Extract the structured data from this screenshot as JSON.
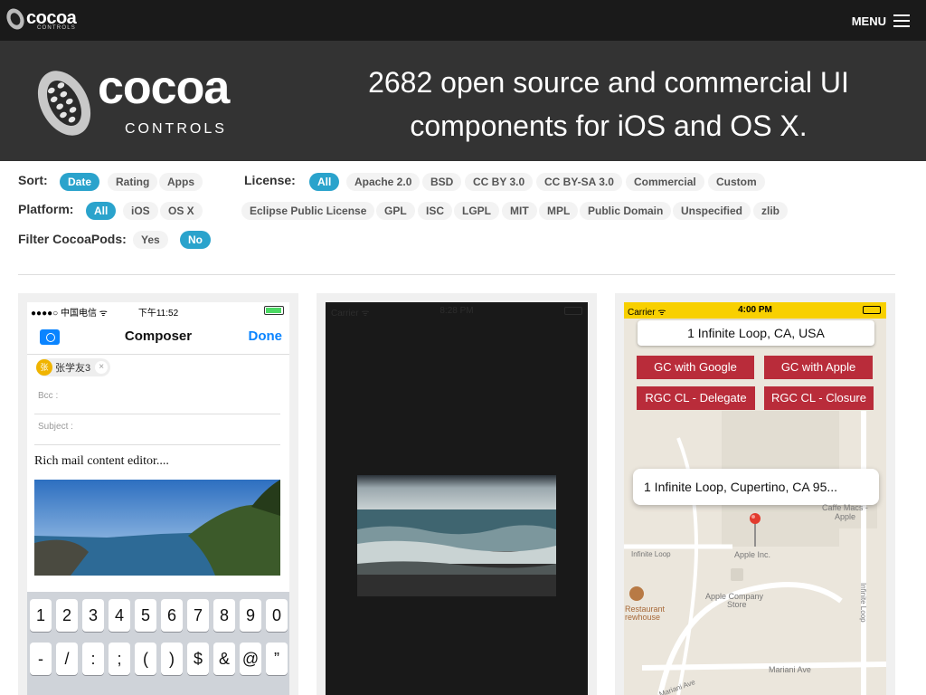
{
  "topbar": {
    "brand": "cocoa",
    "brand_sub": "CONTROLS",
    "menu_label": "MENU"
  },
  "hero": {
    "brand": "cocoa",
    "brand_sub": "CONTROLS",
    "tagline_1": "2682 open source and commercial UI",
    "tagline_2": "components for iOS and OS X."
  },
  "filters": {
    "sort_label": "Sort:",
    "sort": [
      "Date",
      "Rating",
      "Apps"
    ],
    "platform_label": "Platform:",
    "platform": [
      "All",
      "iOS",
      "OS X"
    ],
    "cocoapods_label": "Filter CocoaPods:",
    "cocoapods": [
      "Yes",
      "No"
    ],
    "license_label": "License:",
    "license": [
      "All",
      "Apache 2.0",
      "BSD",
      "CC BY 3.0",
      "CC BY-SA 3.0",
      "Commercial",
      "Custom",
      "Eclipse Public License",
      "GPL",
      "ISC",
      "LGPL",
      "MIT",
      "MPL",
      "Public Domain",
      "Unspecified",
      "zlib"
    ]
  },
  "cards": {
    "composer": {
      "carrier": "●●●●○ 中国电信 ᯤ",
      "time": "下午11:52",
      "title": "Composer",
      "done": "Done",
      "contact": "张学友3",
      "contact_initial": "张",
      "bcc": "Bcc :",
      "subject": "Subject :",
      "body": "Rich mail content editor....",
      "keys_row1": [
        "1",
        "2",
        "3",
        "4",
        "5",
        "6",
        "7",
        "8",
        "9",
        "0"
      ],
      "keys_row2": [
        "-",
        "/",
        ":",
        ";",
        "(",
        ")",
        "$",
        "&",
        "@",
        "”"
      ]
    },
    "photo_viewer": {
      "carrier": "Carrier ᯤ",
      "time": "8:28 PM"
    },
    "map": {
      "carrier": "Carrier ᯤ",
      "time": "4:00 PM",
      "search": "1 Infinite Loop, CA, USA",
      "btn_google": "GC with Google",
      "btn_apple": "GC with Apple",
      "btn_delegate": "RGC CL - Delegate",
      "btn_closure": "RGC CL - Closure",
      "callout": "1 Infinite Loop, Cupertino, CA  95...",
      "labels": [
        "Caffe Macs -",
        "Apple",
        "Infinite Loop",
        "Apple Inc.",
        "Apple Company",
        "Store",
        "Restaurant",
        "rewhouse",
        "Infinite Loop",
        "Mariani Ave",
        "Mariani Ave"
      ]
    }
  },
  "colors": {
    "accent": "#2aa3cc",
    "hero_bg": "#333333",
    "topbar_bg": "#1a1a1a",
    "map_button": "#b92c3a",
    "ios_blue": "#0a84ff"
  }
}
